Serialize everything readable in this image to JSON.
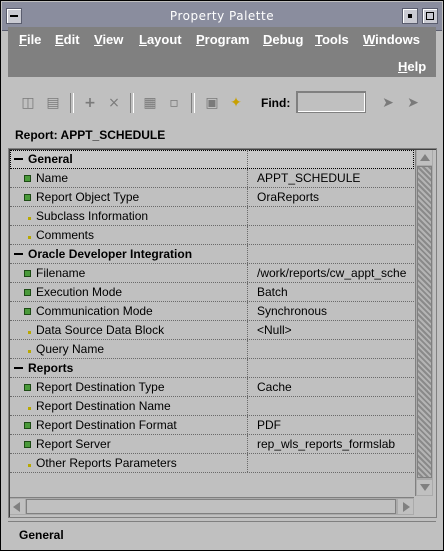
{
  "window": {
    "title": "Property Palette"
  },
  "menu": {
    "items": [
      {
        "label": "File",
        "underline": "F",
        "rest": "ile"
      },
      {
        "label": "Edit",
        "underline": "E",
        "rest": "dit"
      },
      {
        "label": "View",
        "underline": "V",
        "rest": "iew"
      },
      {
        "label": "Layout",
        "underline": "L",
        "rest": "ayout"
      },
      {
        "label": "Program",
        "underline": "P",
        "rest": "rogram"
      },
      {
        "label": "Debug",
        "underline": "D",
        "rest": "ebug"
      },
      {
        "label": "Tools",
        "underline": "T",
        "rest": "ools"
      },
      {
        "label": "Windows",
        "underline": "W",
        "rest": "indows"
      }
    ],
    "help": {
      "label": "Help",
      "underline": "H",
      "rest": "elp"
    }
  },
  "toolbar": {
    "icons": [
      "copy-properties-icon",
      "paste-properties-icon",
      "add-property-icon",
      "delete-property-icon",
      "union-icon",
      "intersection-icon",
      "freeze-icon",
      "pin-icon",
      "find-next-icon",
      "find-previous-icon"
    ],
    "find_label": "Find:",
    "find_value": ""
  },
  "context": {
    "label": "Report: APPT_SCHEDULE"
  },
  "properties": {
    "general": {
      "label": "General",
      "name": {
        "label": "Name",
        "value": "APPT_SCHEDULE"
      },
      "report_object_type": {
        "label": "Report Object Type",
        "value": "OraReports"
      },
      "subclass_information": {
        "label": "Subclass Information",
        "value": ""
      },
      "comments": {
        "label": "Comments",
        "value": ""
      }
    },
    "odi": {
      "label": "Oracle Developer Integration",
      "filename": {
        "label": "Filename",
        "value": "/work/reports/cw_appt_sche"
      },
      "execution_mode": {
        "label": "Execution Mode",
        "value": "Batch"
      },
      "communication_mode": {
        "label": "Communication Mode",
        "value": "Synchronous"
      },
      "data_source_data_block": {
        "label": "Data Source Data Block",
        "value": "<Null>"
      },
      "query_name": {
        "label": "Query Name",
        "value": ""
      }
    },
    "reports": {
      "label": "Reports",
      "report_destination_type": {
        "label": "Report Destination Type",
        "value": "Cache"
      },
      "report_destination_name": {
        "label": "Report Destination Name",
        "value": ""
      },
      "report_destination_format": {
        "label": "Report Destination Format",
        "value": "PDF"
      },
      "report_server": {
        "label": "Report Server",
        "value": "rep_wls_reports_formslab"
      },
      "other_reports_parameters": {
        "label": "Other Reports Parameters",
        "value": ""
      }
    }
  },
  "status": {
    "text": "General"
  }
}
